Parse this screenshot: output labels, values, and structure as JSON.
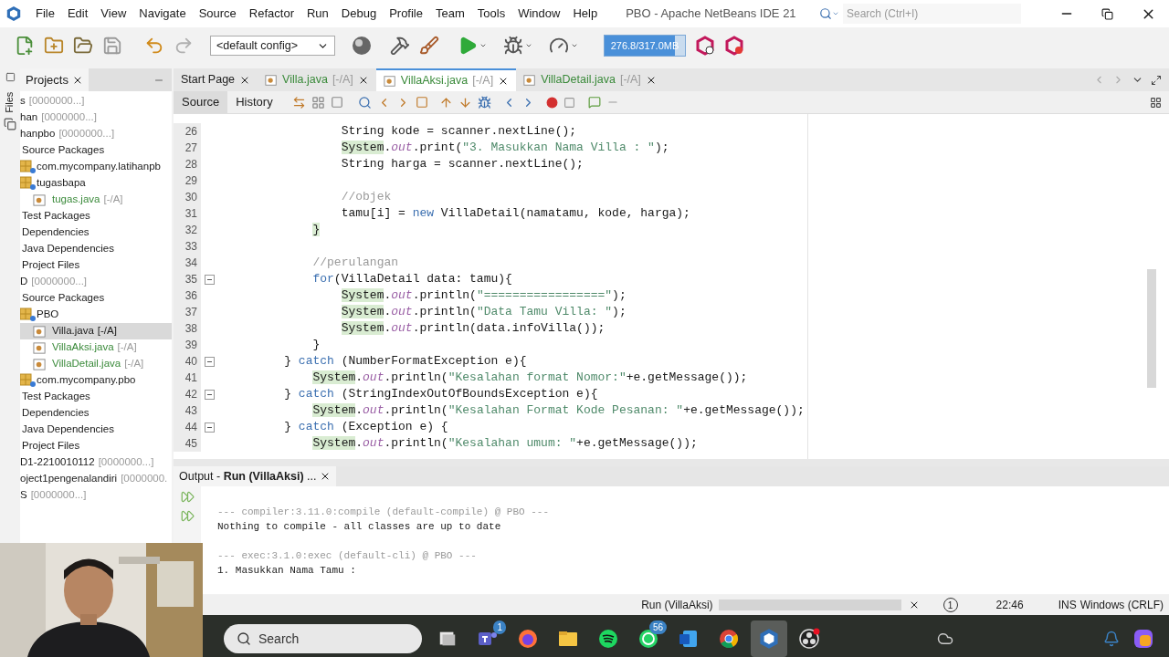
{
  "window": {
    "title": "PBO - Apache NetBeans IDE 21"
  },
  "menu": [
    "File",
    "Edit",
    "View",
    "Navigate",
    "Source",
    "Refactor",
    "Run",
    "Debug",
    "Profile",
    "Team",
    "Tools",
    "Window",
    "Help"
  ],
  "search": {
    "placeholder": "Search (Ctrl+I)"
  },
  "toolbar": {
    "config": "<default config>",
    "memory": {
      "reading": "276.8/317.0MB",
      "level": 0.87
    }
  },
  "projects_panel": {
    "title": "Projects",
    "side_tab": "Files",
    "tree": [
      {
        "label": "s",
        "info": "[0000000...]",
        "selected": false,
        "modified": false
      },
      {
        "label": "han",
        "info": "[0000000...]",
        "selected": false,
        "modified": false
      },
      {
        "label": "hanpbo",
        "info": "[0000000...]",
        "selected": false,
        "modified": false,
        "children": [
          {
            "label": "Source Packages",
            "selected": false,
            "modified": false,
            "children": [
              {
                "label": "com.mycompany.latihanpb",
                "selected": false,
                "modified": false
              },
              {
                "label": "tugasbapa",
                "selected": false,
                "modified": false,
                "children": [
                  {
                    "label": "tugas.java",
                    "info": "[-/A]",
                    "selected": false,
                    "modified": true
                  }
                ]
              }
            ]
          },
          {
            "label": "Test Packages",
            "selected": false,
            "modified": false
          },
          {
            "label": "Dependencies",
            "selected": false,
            "modified": false
          },
          {
            "label": "Java Dependencies",
            "selected": false,
            "modified": false
          },
          {
            "label": "Project Files",
            "selected": false,
            "modified": false
          }
        ]
      },
      {
        "label": "D",
        "info": "[0000000...]",
        "selected": false,
        "modified": false,
        "children": [
          {
            "label": "Source Packages",
            "selected": false,
            "modified": false,
            "children": [
              {
                "label": "PBO",
                "selected": false,
                "modified": false,
                "children": [
                  {
                    "label": "Villa.java",
                    "info": "[-/A]",
                    "selected": true,
                    "modified": false
                  },
                  {
                    "label": "VillaAksi.java",
                    "info": "[-/A]",
                    "selected": false,
                    "modified": true
                  },
                  {
                    "label": "VillaDetail.java",
                    "info": "[-/A]",
                    "selected": false,
                    "modified": true
                  }
                ]
              },
              {
                "label": "com.mycompany.pbo",
                "selected": false,
                "modified": false
              }
            ]
          },
          {
            "label": "Test Packages",
            "selected": false,
            "modified": false
          },
          {
            "label": "Dependencies",
            "selected": false,
            "modified": false
          },
          {
            "label": "Java Dependencies",
            "selected": false,
            "modified": false
          },
          {
            "label": "Project Files",
            "selected": false,
            "modified": false
          }
        ]
      },
      {
        "label": "D1-2210010112",
        "info": "[0000000...]",
        "selected": false,
        "modified": false
      },
      {
        "label": "oject1pengenalandiri",
        "info": "[0000000.",
        "selected": false,
        "modified": false
      },
      {
        "label": "S",
        "info": "[0000000...]",
        "selected": false,
        "modified": false
      }
    ]
  },
  "editor": {
    "tabs": [
      {
        "label": "Start Page",
        "selected": false,
        "modified": false
      },
      {
        "label": "Villa.java",
        "suffix": "[-/A]",
        "selected": false,
        "modified": true
      },
      {
        "label": "VillaAksi.java",
        "suffix": "[-/A]",
        "selected": true,
        "modified": true
      },
      {
        "label": "VillaDetail.java",
        "suffix": "[-/A]",
        "selected": false,
        "modified": true
      }
    ],
    "views": [
      {
        "label": "Source",
        "selected": true
      },
      {
        "label": "History",
        "selected": false
      }
    ],
    "lines": [
      {
        "number": "26",
        "fold": false,
        "segments": [
          {
            "kind": "text",
            "text": "            String kode = scanner.nextLine();"
          }
        ]
      },
      {
        "number": "27",
        "fold": false,
        "segments": [
          {
            "kind": "mark",
            "text": "            System"
          },
          {
            "kind": "text",
            "text": "."
          },
          {
            "kind": "field",
            "text": "out"
          },
          {
            "kind": "text",
            "text": ".print("
          },
          {
            "kind": "string",
            "text": "\"3. Masukkan Nama Villa : \""
          },
          {
            "kind": "text",
            "text": ");"
          }
        ]
      },
      {
        "number": "28",
        "fold": false,
        "segments": [
          {
            "kind": "text",
            "text": "            String harga = scanner.nextLine();"
          }
        ]
      },
      {
        "number": "29",
        "fold": false
      },
      {
        "number": "30",
        "fold": false,
        "segments": [
          {
            "kind": "comment",
            "text": "            //objek"
          }
        ]
      },
      {
        "number": "31",
        "fold": false,
        "segments": [
          {
            "kind": "text",
            "text": "            tamu[i] = "
          },
          {
            "kind": "keyword",
            "text": "new"
          },
          {
            "kind": "text",
            "text": " VillaDetail(namatamu, kode, harga);"
          }
        ]
      },
      {
        "number": "32",
        "fold": false,
        "segments": [
          {
            "kind": "mark",
            "text": "        }"
          }
        ]
      },
      {
        "number": "33",
        "fold": false
      },
      {
        "number": "34",
        "fold": false,
        "segments": [
          {
            "kind": "comment",
            "text": "        //perulangan"
          }
        ]
      },
      {
        "number": "35",
        "fold": true,
        "segments": [
          {
            "kind": "keyword",
            "text": "        for"
          },
          {
            "kind": "text",
            "text": "(VillaDetail data: tamu){"
          }
        ]
      },
      {
        "number": "36",
        "fold": false,
        "segments": [
          {
            "kind": "mark",
            "text": "            System"
          },
          {
            "kind": "text",
            "text": "."
          },
          {
            "kind": "field",
            "text": "out"
          },
          {
            "kind": "text",
            "text": ".println("
          },
          {
            "kind": "string",
            "text": "\"=================\""
          },
          {
            "kind": "text",
            "text": ");"
          }
        ]
      },
      {
        "number": "37",
        "fold": false,
        "segments": [
          {
            "kind": "mark",
            "text": "            System"
          },
          {
            "kind": "text",
            "text": "."
          },
          {
            "kind": "field",
            "text": "out"
          },
          {
            "kind": "text",
            "text": ".println("
          },
          {
            "kind": "string",
            "text": "\"Data Tamu Villa: \""
          },
          {
            "kind": "text",
            "text": ");"
          }
        ]
      },
      {
        "number": "38",
        "fold": false,
        "segments": [
          {
            "kind": "mark",
            "text": "            System"
          },
          {
            "kind": "text",
            "text": "."
          },
          {
            "kind": "field",
            "text": "out"
          },
          {
            "kind": "text",
            "text": ".println(data.infoVilla());"
          }
        ]
      },
      {
        "number": "39",
        "fold": false,
        "segments": [
          {
            "kind": "text",
            "text": "        }"
          }
        ]
      },
      {
        "number": "40",
        "fold": true,
        "segments": [
          {
            "kind": "text",
            "text": "    } "
          },
          {
            "kind": "keyword",
            "text": "catch"
          },
          {
            "kind": "text",
            "text": " (NumberFormatException e){"
          }
        ]
      },
      {
        "number": "41",
        "fold": false,
        "segments": [
          {
            "kind": "mark",
            "text": "        System"
          },
          {
            "kind": "text",
            "text": "."
          },
          {
            "kind": "field",
            "text": "out"
          },
          {
            "kind": "text",
            "text": ".println("
          },
          {
            "kind": "string",
            "text": "\"Kesalahan format Nomor:\""
          },
          {
            "kind": "text",
            "text": "+e.getMessage());"
          }
        ]
      },
      {
        "number": "42",
        "fold": true,
        "segments": [
          {
            "kind": "text",
            "text": "    } "
          },
          {
            "kind": "keyword",
            "text": "catch"
          },
          {
            "kind": "text",
            "text": " (StringIndexOutOfBoundsException e){"
          }
        ]
      },
      {
        "number": "43",
        "fold": false,
        "segments": [
          {
            "kind": "mark",
            "text": "        System"
          },
          {
            "kind": "text",
            "text": "."
          },
          {
            "kind": "field",
            "text": "out"
          },
          {
            "kind": "text",
            "text": ".println("
          },
          {
            "kind": "string",
            "text": "\"Kesalahan Format Kode Pesanan: \""
          },
          {
            "kind": "text",
            "text": "+e.getMessage());"
          }
        ]
      },
      {
        "number": "44",
        "fold": true,
        "segments": [
          {
            "kind": "text",
            "text": "    } "
          },
          {
            "kind": "keyword",
            "text": "catch"
          },
          {
            "kind": "text",
            "text": " (Exception e) {"
          }
        ]
      },
      {
        "number": "45",
        "fold": false,
        "segments": [
          {
            "kind": "mark",
            "text": "        System"
          },
          {
            "kind": "text",
            "text": "."
          },
          {
            "kind": "field",
            "text": "out"
          },
          {
            "kind": "text",
            "text": ".println("
          },
          {
            "kind": "string",
            "text": "\"Kesalahan umum: \""
          },
          {
            "kind": "text",
            "text": "+e.getMessage());"
          }
        ]
      }
    ]
  },
  "output": {
    "tab": "Output - **Run (VillaAksi)** ...",
    "lines": [
      {
        "kind": "info",
        "text": "--- compiler:3.11.0:compile (default-compile) @ PBO ---"
      },
      {
        "kind": "text",
        "text": "Nothing to compile - all classes are up to date"
      },
      {
        "kind": "blank"
      },
      {
        "kind": "info",
        "text": "--- exec:3.1.0:exec (default-cli) @ PBO ---"
      },
      {
        "kind": "text",
        "text": "1. Masukkan Nama Tamu :"
      }
    ]
  },
  "status_bar": {
    "task": "Run (VillaAksi)",
    "notifications": "1",
    "position": "22:46",
    "mode": "INS",
    "line_endings": "Windows (CRLF)"
  },
  "taskbar": {
    "search": {
      "placeholder": "Search"
    },
    "apps": [
      {
        "kind": "taskview",
        "selected": false
      },
      {
        "kind": "teams",
        "badge": "1",
        "selected": false
      },
      {
        "kind": "firefox",
        "selected": false
      },
      {
        "kind": "explorer",
        "selected": false
      },
      {
        "kind": "spotify",
        "selected": false
      },
      {
        "kind": "whatsapp",
        "badge": "56",
        "selected": false
      },
      {
        "kind": "word",
        "selected": false
      },
      {
        "kind": "chrome",
        "selected": false
      },
      {
        "kind": "netbeans",
        "selected": true
      },
      {
        "kind": "obs",
        "selected": false
      }
    ]
  }
}
